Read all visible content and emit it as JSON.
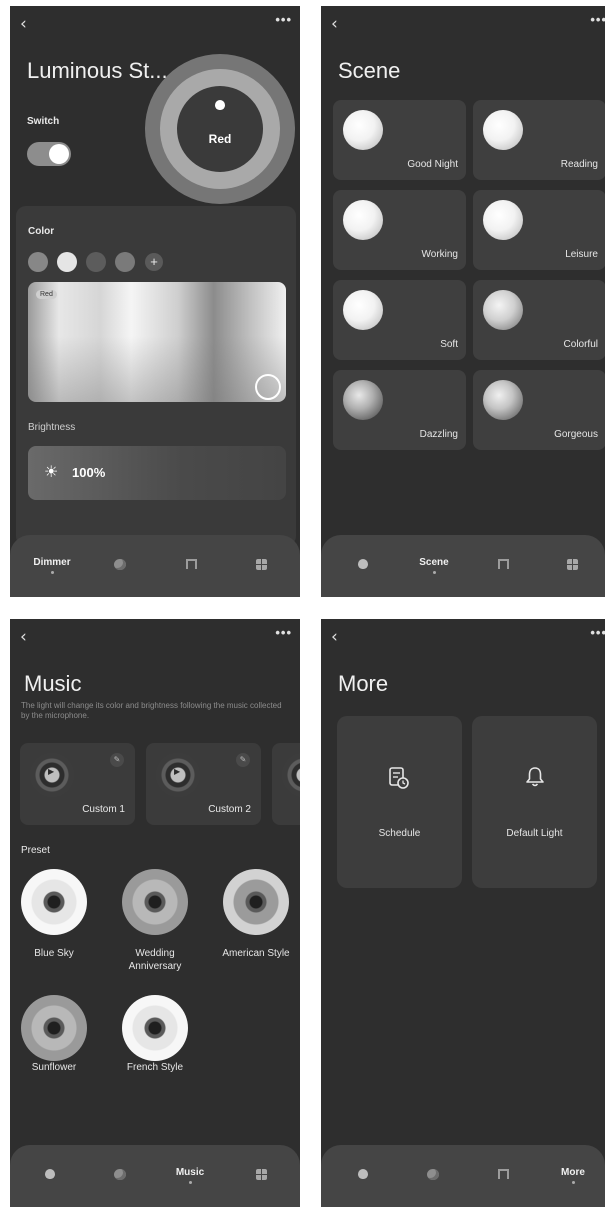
{
  "dimmer": {
    "title": "Luminous St...",
    "switch_label": "Switch",
    "bulb_color": "Red",
    "color_label": "Color",
    "color_tag": "Red",
    "brightness_label": "Brightness",
    "brightness_value": "100%",
    "tabs": [
      "Dimmer",
      "",
      "",
      ""
    ],
    "active_tab": "Dimmer"
  },
  "scene": {
    "title": "Scene",
    "items": [
      "Good Night",
      "Reading",
      "Working",
      "Leisure",
      "Soft",
      "Colorful",
      "Dazzling",
      "Gorgeous"
    ],
    "active_tab": "Scene"
  },
  "music": {
    "title": "Music",
    "description": "The light will change its color and brightness following the music collected by the microphone.",
    "custom": [
      "Custom 1",
      "Custom 2"
    ],
    "preset_label": "Preset",
    "presets": [
      "Blue Sky",
      "Wedding Anniversary",
      "American Style",
      "Sunflower",
      "French Style"
    ],
    "active_tab": "Music"
  },
  "more": {
    "title": "More",
    "items": [
      "Schedule",
      "Default Light"
    ],
    "active_tab": "More"
  },
  "icons": {
    "back": "back-chevron-icon",
    "menu": "more-dots-icon",
    "bulb": "bulb-icon",
    "palette": "palette-icon",
    "music": "music-icon",
    "grid": "grid-icon"
  },
  "glyphs": {
    "back": "‹",
    "dots": "•••",
    "plus": "+",
    "sun": "☀",
    "pencil": "✎",
    "play": "▶"
  }
}
